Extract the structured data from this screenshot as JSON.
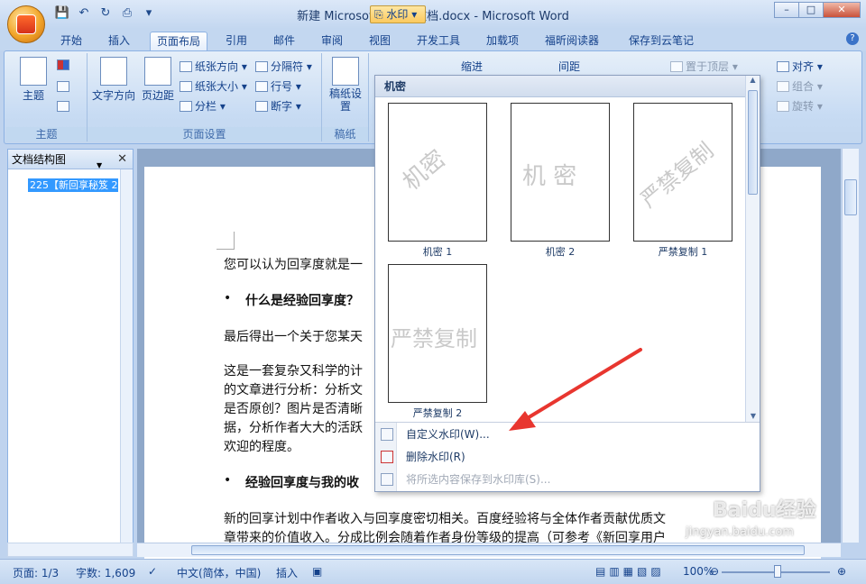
{
  "window": {
    "title": "新建 Microsoft Word 文档.docx - Microsoft Word",
    "controls": [
      "–",
      "□",
      "✕"
    ]
  },
  "tabs": [
    "开始",
    "插入",
    "页面布局",
    "引用",
    "邮件",
    "审阅",
    "视图",
    "开发工具",
    "加载项",
    "福昕阅读器",
    "保存到云笔记"
  ],
  "active_tab": "页面布局",
  "ribbon": {
    "theme": {
      "btn": "主题",
      "label": "主题"
    },
    "page_setup": {
      "text_direction": "文字方向",
      "margins": "页边距",
      "orientation": "纸张方向 ▾",
      "size": "纸张大小 ▾",
      "columns": "分栏 ▾",
      "breaks": "分隔符 ▾",
      "line_numbers": "行号 ▾",
      "hyphenation": "断字 ▾",
      "label": "页面设置"
    },
    "draft": {
      "btn": "稿纸设置",
      "label": "稿纸"
    },
    "watermark_btn": "水印 ▾",
    "indent": "缩进",
    "spacing": "间距",
    "arrange": {
      "bring_front": "置于顶层 ▾",
      "align": "对齐 ▾",
      "group": "组合 ▾",
      "rotate": "旋转 ▾"
    }
  },
  "doc_map": {
    "title": "文档结构图",
    "item": "225【新回享秘笈 2"
  },
  "document": {
    "p1": "您可以认为回享度就是一",
    "h1": "什么是经验回享度？",
    "p2": "最后得出一个关于您某天",
    "p3a": "这是一套复杂又科学的计",
    "p3b": "的文章进行分析：分析文",
    "p3c": "是否原创？图片是否清晰",
    "p3d": "据，分析作者大大的活跃",
    "p3e": "欢迎的程度。",
    "h2": "经验回享度与我的收",
    "p4a": "新的回享计划中作者收入与回享度密切相关。百度经验将与全体作者贡献优质文",
    "p4b": "章带来的价值收入。分成比例会随着作者身份等级的提高（可参考《新回享用户"
  },
  "watermark_menu": {
    "section": "机密",
    "items": [
      {
        "caption": "机密 1",
        "wm": "机密"
      },
      {
        "caption": "机密 2",
        "wm": "机 密"
      },
      {
        "caption": "严禁复制 1",
        "wm": "严禁复制"
      },
      {
        "caption": "严禁复制 2",
        "wm": "严禁复制"
      }
    ],
    "custom": "自定义水印(W)...",
    "remove": "删除水印(R)",
    "save": "将所选内容保存到水印库(S)..."
  },
  "status": {
    "page": "页面: 1/3",
    "words": "字数: 1,609",
    "lang": "中文(简体，中国)",
    "insert": "插入",
    "zoom": "100%"
  },
  "colors": {
    "accent": "#15428b",
    "arrow": "#e8362f"
  },
  "watermark_overlay": {
    "logo": "Baidu经验",
    "url": "jingyan.baidu.com"
  }
}
